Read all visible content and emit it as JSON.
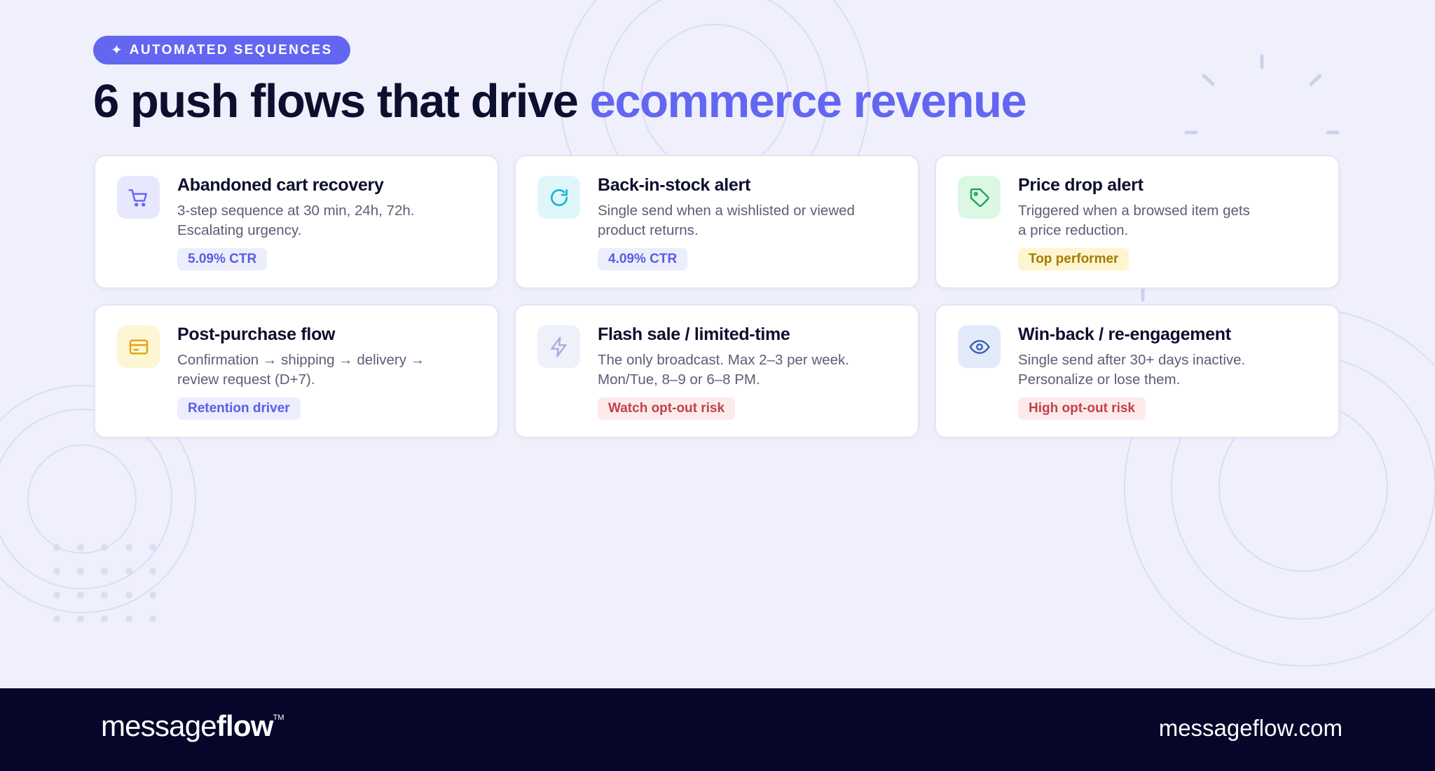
{
  "badge": {
    "spark": "✦",
    "label": "AUTOMATED SEQUENCES"
  },
  "headline": {
    "lead": "6 push flows that drive",
    "accent": "ecommerce revenue"
  },
  "colors": {
    "background": "#eff0fb",
    "accent": "#6366f1",
    "ink": "#0d0f2e",
    "footer": "#050629"
  },
  "cards": [
    {
      "icon": "shopping-cart-icon",
      "title": "Abandoned cart recovery",
      "desc_line1": "3-step sequence at 30 min, 24h, 72h.",
      "desc_line2": "Escalating urgency.",
      "tag": "5.09% CTR"
    },
    {
      "icon": "refresh-icon",
      "title": "Back-in-stock alert",
      "desc_line1": "Single send when a wishlisted or viewed",
      "desc_line2": "product returns.",
      "tag": "4.09% CTR"
    },
    {
      "icon": "price-tag-icon",
      "title": "Price drop alert",
      "desc_line1": "Triggered when a browsed item gets",
      "desc_line2": "a price reduction.",
      "tag": "Top performer"
    },
    {
      "icon": "credit-card-icon",
      "title": "Post-purchase flow",
      "desc_line1": "Confirmation → shipping → delivery →",
      "desc_line2": "review request (D+7).",
      "tag": "Retention driver"
    },
    {
      "icon": "lightning-icon",
      "title": "Flash sale / limited-time",
      "desc_line1": "The only broadcast. Max 2–3 per week.",
      "desc_line2": "Mon/Tue, 8–9 or 6–8 PM.",
      "tag": "Watch opt-out risk"
    },
    {
      "icon": "eye-icon",
      "title": "Win-back / re-engagement",
      "desc_line1": "Single send after 30+ days inactive.",
      "desc_line2": "Personalize or lose them.",
      "tag": "High opt-out risk"
    }
  ],
  "footer": {
    "logo_light": "message",
    "logo_bold": "flow",
    "logo_tm": "TM",
    "website": "messageflow.com"
  }
}
